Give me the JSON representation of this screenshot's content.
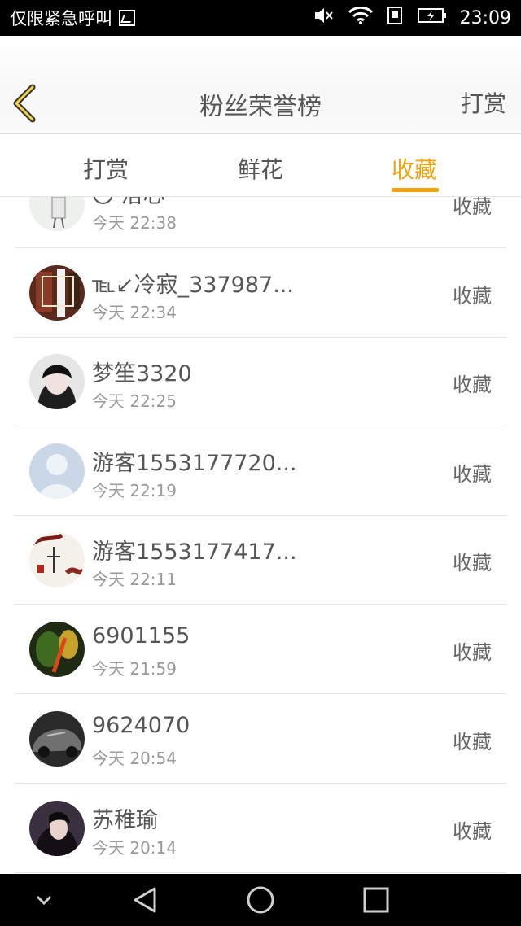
{
  "status_bar": {
    "carrier": "仅限紧急呼叫",
    "time": "23:09",
    "icons": [
      "sim-card-icon",
      "mute-icon",
      "wifi-icon",
      "data-saver-icon",
      "battery-charging-icon"
    ]
  },
  "header": {
    "back_icon": "chevron-left-icon",
    "title": "粉丝荣誉榜",
    "right_label": "打赏"
  },
  "tabs": [
    {
      "label": "打赏",
      "active": false
    },
    {
      "label": "鲜花",
      "active": false
    },
    {
      "label": "收藏",
      "active": true
    }
  ],
  "list": {
    "items": [
      {
        "name": "〇 洛心",
        "time": "今天 22:38",
        "action": "收藏"
      },
      {
        "name": "℡↙冷寂_337987...",
        "time": "今天 22:34",
        "action": "收藏"
      },
      {
        "name": "梦笙3320",
        "time": "今天 22:25",
        "action": "收藏"
      },
      {
        "name": "游客1553177720...",
        "time": "今天 22:19",
        "action": "收藏"
      },
      {
        "name": "游客1553177417...",
        "time": "今天 22:11",
        "action": "收藏"
      },
      {
        "name": "6901155",
        "time": "今天 21:59",
        "action": "收藏"
      },
      {
        "name": "9624070",
        "time": "今天 20:54",
        "action": "收藏"
      },
      {
        "name": "苏稚瑜",
        "time": "今天 20:14",
        "action": "收藏"
      }
    ]
  },
  "nav_bar": {
    "icons": [
      "chevron-down-icon",
      "back-triangle-icon",
      "home-circle-icon",
      "recents-square-icon"
    ]
  },
  "colors": {
    "accent": "#f1a30b",
    "text": "#555555",
    "subtext": "#999999"
  }
}
